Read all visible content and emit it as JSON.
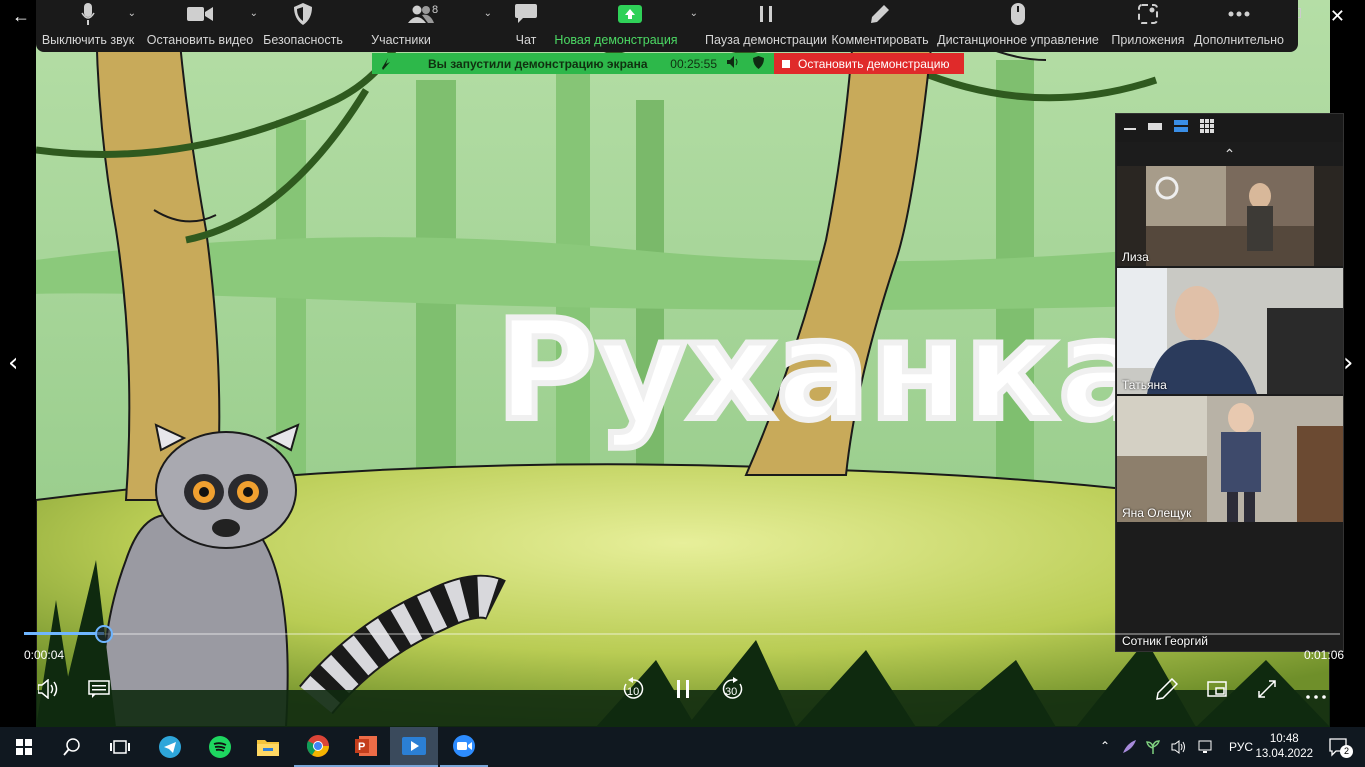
{
  "toolbar": {
    "items": [
      {
        "label": "Выключить звук",
        "icon": "microphone-icon"
      },
      {
        "label": "Остановить видео",
        "icon": "video-camera-icon"
      },
      {
        "label": "Безопасность",
        "icon": "shield-icon"
      },
      {
        "label": "Участники",
        "icon": "participants-icon",
        "count": "8"
      },
      {
        "label": "Чат",
        "icon": "chat-icon"
      },
      {
        "label": "Новая демонстрация",
        "icon": "share-screen-icon"
      },
      {
        "label": "Пауза демонстрации",
        "icon": "pause-icon"
      },
      {
        "label": "Комментировать",
        "icon": "pencil-icon"
      },
      {
        "label": "Дистанционное управление",
        "icon": "mouse-icon"
      },
      {
        "label": "Приложения",
        "icon": "apps-icon"
      },
      {
        "label": "Дополнительно",
        "icon": "more-icon"
      }
    ],
    "accent_green": "#4cd964"
  },
  "share_bar": {
    "text": "Вы запустили демонстрацию экрана",
    "timer": "00:25:55",
    "stop_label": "Остановить демонстрацию"
  },
  "video": {
    "title_text": "Руханка",
    "elapsed": "0:00:04",
    "total": "0:01:06",
    "progress": 0.061,
    "rewind_seconds": "10",
    "forward_seconds": "30"
  },
  "participants": [
    {
      "name": "Лиза"
    },
    {
      "name": "Татьяна"
    },
    {
      "name": "Яна Олещук"
    },
    {
      "name": "Сотник Георгий"
    }
  ],
  "taskbar": {
    "language": "РУС",
    "time": "10:48",
    "date": "13.04.2022",
    "notifications": "2",
    "apps": [
      "start-icon",
      "search-icon",
      "task-view-icon",
      "telegram-icon",
      "spotify-icon",
      "file-explorer-icon",
      "chrome-icon",
      "powerpoint-icon",
      "media-player-icon",
      "zoom-icon"
    ]
  }
}
